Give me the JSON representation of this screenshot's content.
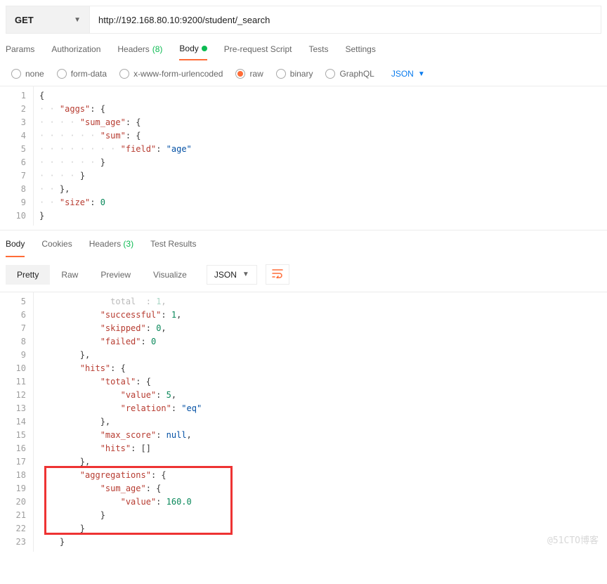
{
  "request": {
    "method": "GET",
    "url": "http://192.168.80.10:9200/student/_search"
  },
  "req_tabs": {
    "params": "Params",
    "auth": "Authorization",
    "headers": "Headers",
    "headers_count": "(8)",
    "body": "Body",
    "prereq": "Pre-request Script",
    "tests": "Tests",
    "settings": "Settings"
  },
  "body_opts": {
    "none": "none",
    "formdata": "form-data",
    "xwww": "x-www-form-urlencoded",
    "raw": "raw",
    "binary": "binary",
    "graphql": "GraphQL",
    "json": "JSON"
  },
  "req_body_lines": [
    {
      "n": "1",
      "indent": 0,
      "t": [
        {
          "p": "{"
        }
      ]
    },
    {
      "n": "2",
      "indent": 1,
      "t": [
        {
          "k": "\"aggs\""
        },
        {
          "p": ": {"
        }
      ]
    },
    {
      "n": "3",
      "indent": 2,
      "t": [
        {
          "k": "\"sum_age\""
        },
        {
          "p": ": {"
        }
      ]
    },
    {
      "n": "4",
      "indent": 3,
      "t": [
        {
          "k": "\"sum\""
        },
        {
          "p": ": {"
        }
      ]
    },
    {
      "n": "5",
      "indent": 4,
      "t": [
        {
          "k": "\"field\""
        },
        {
          "p": ": "
        },
        {
          "s": "\"age\""
        }
      ]
    },
    {
      "n": "6",
      "indent": 3,
      "t": [
        {
          "p": "}"
        }
      ]
    },
    {
      "n": "7",
      "indent": 2,
      "t": [
        {
          "p": "}"
        }
      ]
    },
    {
      "n": "8",
      "indent": 1,
      "t": [
        {
          "p": "},"
        }
      ]
    },
    {
      "n": "9",
      "indent": 1,
      "t": [
        {
          "k": "\"size\""
        },
        {
          "p": ": "
        },
        {
          "num": "0"
        }
      ]
    },
    {
      "n": "10",
      "indent": 0,
      "t": [
        {
          "p": "}"
        }
      ]
    }
  ],
  "resp_tabs": {
    "body": "Body",
    "cookies": "Cookies",
    "headers": "Headers",
    "headers_count": "(3)",
    "tests": "Test Results"
  },
  "view_modes": {
    "pretty": "Pretty",
    "raw": "Raw",
    "preview": "Preview",
    "visualize": "Visualize",
    "json": "JSON"
  },
  "resp_lines": [
    {
      "n": "5",
      "indent": 3,
      "t": [
        {
          "p": "  total  : "
        },
        {
          "num": "1"
        },
        {
          "p": ","
        }
      ],
      "dim": true
    },
    {
      "n": "6",
      "indent": 3,
      "t": [
        {
          "k": "\"successful\""
        },
        {
          "p": ": "
        },
        {
          "num": "1"
        },
        {
          "p": ","
        }
      ]
    },
    {
      "n": "7",
      "indent": 3,
      "t": [
        {
          "k": "\"skipped\""
        },
        {
          "p": ": "
        },
        {
          "num": "0"
        },
        {
          "p": ","
        }
      ]
    },
    {
      "n": "8",
      "indent": 3,
      "t": [
        {
          "k": "\"failed\""
        },
        {
          "p": ": "
        },
        {
          "num": "0"
        }
      ]
    },
    {
      "n": "9",
      "indent": 2,
      "t": [
        {
          "p": "},"
        }
      ]
    },
    {
      "n": "10",
      "indent": 2,
      "t": [
        {
          "k": "\"hits\""
        },
        {
          "p": ": {"
        }
      ]
    },
    {
      "n": "11",
      "indent": 3,
      "t": [
        {
          "k": "\"total\""
        },
        {
          "p": ": {"
        }
      ]
    },
    {
      "n": "12",
      "indent": 4,
      "t": [
        {
          "k": "\"value\""
        },
        {
          "p": ": "
        },
        {
          "num": "5"
        },
        {
          "p": ","
        }
      ]
    },
    {
      "n": "13",
      "indent": 4,
      "t": [
        {
          "k": "\"relation\""
        },
        {
          "p": ": "
        },
        {
          "s": "\"eq\""
        }
      ]
    },
    {
      "n": "14",
      "indent": 3,
      "t": [
        {
          "p": "},"
        }
      ]
    },
    {
      "n": "15",
      "indent": 3,
      "t": [
        {
          "k": "\"max_score\""
        },
        {
          "p": ": "
        },
        {
          "nul": "null"
        },
        {
          "p": ","
        }
      ]
    },
    {
      "n": "16",
      "indent": 3,
      "t": [
        {
          "k": "\"hits\""
        },
        {
          "p": ": []"
        }
      ]
    },
    {
      "n": "17",
      "indent": 2,
      "t": [
        {
          "p": "},"
        }
      ]
    },
    {
      "n": "18",
      "indent": 2,
      "t": [
        {
          "k": "\"aggregations\""
        },
        {
          "p": ": {"
        }
      ]
    },
    {
      "n": "19",
      "indent": 3,
      "t": [
        {
          "k": "\"sum_age\""
        },
        {
          "p": ": {"
        }
      ]
    },
    {
      "n": "20",
      "indent": 4,
      "t": [
        {
          "k": "\"value\""
        },
        {
          "p": ": "
        },
        {
          "num": "160.0"
        }
      ]
    },
    {
      "n": "21",
      "indent": 3,
      "t": [
        {
          "p": "}"
        }
      ]
    },
    {
      "n": "22",
      "indent": 2,
      "t": [
        {
          "p": "}"
        }
      ]
    },
    {
      "n": "23",
      "indent": 1,
      "t": [
        {
          "p": "}"
        }
      ]
    }
  ],
  "watermark": "@51CTO博客"
}
